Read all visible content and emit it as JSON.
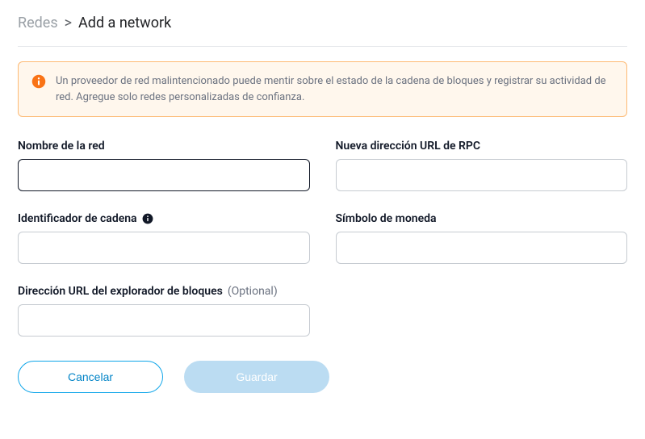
{
  "breadcrumb": {
    "previous": "Redes",
    "separator": ">",
    "current": "Add a network"
  },
  "warning": {
    "text": "Un proveedor de red malintencionado puede mentir sobre el estado de la cadena de bloques y registrar su actividad de red. Agregue solo redes personalizadas de confianza."
  },
  "fields": {
    "network_name": {
      "label": "Nombre de la red",
      "value": ""
    },
    "rpc_url": {
      "label": "Nueva dirección URL de RPC",
      "value": ""
    },
    "chain_id": {
      "label": "Identificador de cadena",
      "value": ""
    },
    "currency_symbol": {
      "label": "Símbolo de moneda",
      "value": ""
    },
    "block_explorer": {
      "label": "Dirección URL del explorador de bloques",
      "optional": "(Optional)",
      "value": ""
    }
  },
  "buttons": {
    "cancel": "Cancelar",
    "save": "Guardar"
  }
}
